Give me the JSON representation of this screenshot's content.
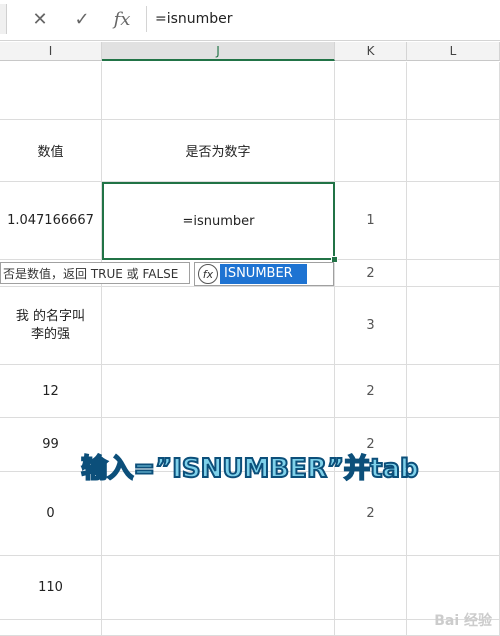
{
  "formula_bar": {
    "cancel_icon": "close-icon",
    "enter_icon": "checkmark-icon",
    "fx_label": "fx",
    "formula": "=isnumber"
  },
  "columns": [
    {
      "label": "I"
    },
    {
      "label": "J"
    },
    {
      "label": "K"
    },
    {
      "label": "L"
    }
  ],
  "rows": [
    {
      "i": "",
      "j": "",
      "k": ""
    },
    {
      "i": "数值",
      "j": "是否为数字",
      "k": ""
    },
    {
      "i": "1.047166667",
      "j": "=isnumber",
      "k": "1"
    },
    {
      "i": "",
      "j": "",
      "k": "2"
    },
    {
      "i": "我    的名字叫\n李的强",
      "j": "",
      "k": "3"
    },
    {
      "i": "12",
      "j": "",
      "k": "2"
    },
    {
      "i": "99",
      "j": "",
      "k": "2"
    },
    {
      "i": "0",
      "j": "",
      "k": "2"
    },
    {
      "i": "110",
      "j": "",
      "k": ""
    },
    {
      "i": "",
      "j": "",
      "k": ""
    }
  ],
  "tooltip": "否是数值，返回 TRUE 或 FALSE",
  "autocomplete": {
    "icon": "function-icon",
    "item": "ISNUMBER"
  },
  "overlay": "输入=”ISNUMBER”并tab",
  "watermark": "Bai 经验",
  "colors": {
    "accent": "#217346",
    "selection": "#1e73d2"
  }
}
